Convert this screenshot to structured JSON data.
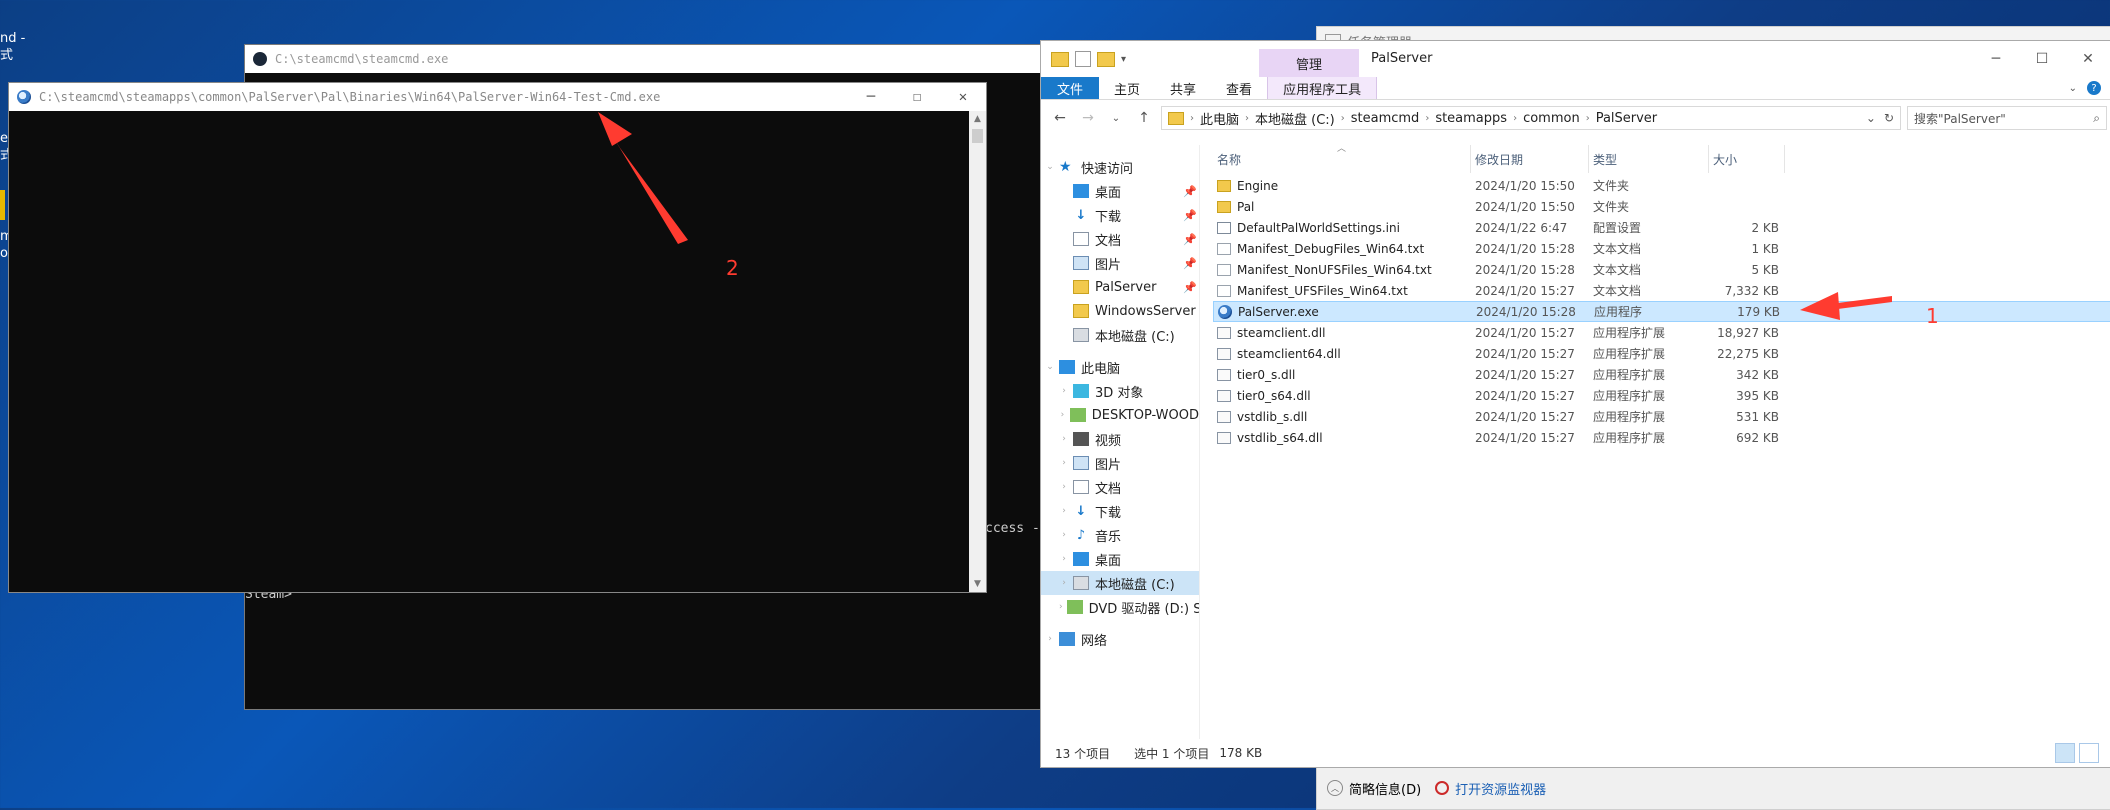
{
  "desktop": {
    "frag1": "nd -",
    "frag2": "式",
    "frag3": "er",
    "frag4": "式",
    "frag5": "m",
    "frag6": "o"
  },
  "taskmgr": {
    "title": "任务管理器",
    "brief_label": "简略信息(D)",
    "resmon_label": "打开资源监视器"
  },
  "steamcmd": {
    "title": "C:\\steamcmd\\steamcmd.exe",
    "line_prompt": "Steam>",
    "line_partial": "ccess -"
  },
  "palconsole": {
    "title": "C:\\steamcmd\\steamapps\\common\\PalServer\\Pal\\Binaries\\Win64\\PalServer-Win64-Test-Cmd.exe",
    "minimize": "─",
    "maximize": "☐",
    "close": "✕"
  },
  "explorer": {
    "window_title": "PalServer",
    "manage_tab": "管理",
    "ribbon": {
      "file": "文件",
      "home": "主页",
      "share": "共享",
      "view": "查看",
      "app_tools": "应用程序工具"
    },
    "breadcrumb": [
      "此电脑",
      "本地磁盘 (C:)",
      "steamcmd",
      "steamapps",
      "common",
      "PalServer"
    ],
    "search_placeholder": "搜索\"PalServer\"",
    "columns": {
      "name": "名称",
      "date": "修改日期",
      "type": "类型",
      "size": "大小"
    },
    "nav": {
      "quick_access": "快速访问",
      "desktop": "桌面",
      "downloads": "下载",
      "documents": "文档",
      "pictures": "图片",
      "palserver": "PalServer",
      "windowsserver": "WindowsServer",
      "local_disk": "本地磁盘 (C:)",
      "this_pc": "此电脑",
      "objects3d": "3D 对象",
      "desktop_wood": "DESKTOP-WOOD",
      "videos": "视频",
      "pictures2": "图片",
      "documents2": "文档",
      "downloads2": "下载",
      "music": "音乐",
      "desktop2": "桌面",
      "local_disk2": "本地磁盘 (C:)",
      "dvd": "DVD 驱动器 (D:) S",
      "network": "网络"
    },
    "files": [
      {
        "name": "Engine",
        "date": "2024/1/20 15:50",
        "type": "文件夹",
        "size": "",
        "icon": "folder"
      },
      {
        "name": "Pal",
        "date": "2024/1/20 15:50",
        "type": "文件夹",
        "size": "",
        "icon": "folder"
      },
      {
        "name": "DefaultPalWorldSettings.ini",
        "date": "2024/1/22 6:47",
        "type": "配置设置",
        "size": "2 KB",
        "icon": "ini"
      },
      {
        "name": "Manifest_DebugFiles_Win64.txt",
        "date": "2024/1/20 15:28",
        "type": "文本文档",
        "size": "1 KB",
        "icon": "doc"
      },
      {
        "name": "Manifest_NonUFSFiles_Win64.txt",
        "date": "2024/1/20 15:28",
        "type": "文本文档",
        "size": "5 KB",
        "icon": "doc"
      },
      {
        "name": "Manifest_UFSFiles_Win64.txt",
        "date": "2024/1/20 15:27",
        "type": "文本文档",
        "size": "7,332 KB",
        "icon": "doc"
      },
      {
        "name": "PalServer.exe",
        "date": "2024/1/20 15:28",
        "type": "应用程序",
        "size": "179 KB",
        "icon": "exe"
      },
      {
        "name": "steamclient.dll",
        "date": "2024/1/20 15:27",
        "type": "应用程序扩展",
        "size": "18,927 KB",
        "icon": "dll"
      },
      {
        "name": "steamclient64.dll",
        "date": "2024/1/20 15:27",
        "type": "应用程序扩展",
        "size": "22,275 KB",
        "icon": "dll"
      },
      {
        "name": "tier0_s.dll",
        "date": "2024/1/20 15:27",
        "type": "应用程序扩展",
        "size": "342 KB",
        "icon": "dll"
      },
      {
        "name": "tier0_s64.dll",
        "date": "2024/1/20 15:27",
        "type": "应用程序扩展",
        "size": "395 KB",
        "icon": "dll"
      },
      {
        "name": "vstdlib_s.dll",
        "date": "2024/1/20 15:27",
        "type": "应用程序扩展",
        "size": "531 KB",
        "icon": "dll"
      },
      {
        "name": "vstdlib_s64.dll",
        "date": "2024/1/20 15:27",
        "type": "应用程序扩展",
        "size": "692 KB",
        "icon": "dll"
      }
    ],
    "selected_index": 6,
    "status": {
      "count": "13 个项目",
      "selected": "选中 1 个项目",
      "selected_size": "178 KB"
    }
  },
  "annotations": {
    "label1": "1",
    "label2": "2",
    "arrow_color": "#ff3b30"
  }
}
